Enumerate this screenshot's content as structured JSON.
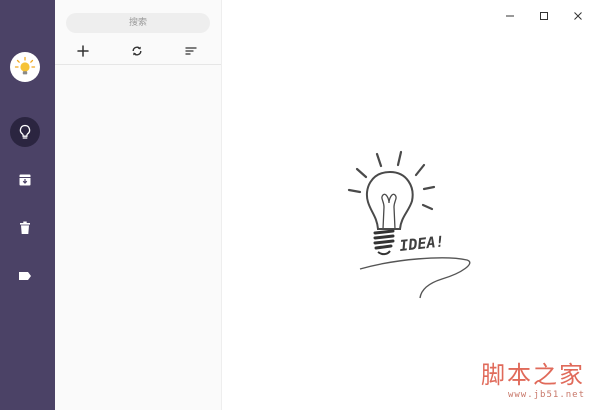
{
  "app": {
    "window_controls": [
      "minimize",
      "maximize",
      "close"
    ]
  },
  "sidebar": {
    "logo_icon": "lightbulb-logo-icon",
    "items": [
      {
        "id": "ideas",
        "icon": "lightbulb-icon",
        "active": true
      },
      {
        "id": "archive",
        "icon": "archive-icon",
        "active": false
      },
      {
        "id": "trash",
        "icon": "trash-icon",
        "active": false
      },
      {
        "id": "tags",
        "icon": "tag-icon",
        "active": false
      }
    ],
    "colors": {
      "background": "#4b4266",
      "active": "#2b2540"
    }
  },
  "list_panel": {
    "search_placeholder": "搜索",
    "toolbar": [
      {
        "id": "add",
        "icon": "plus-icon"
      },
      {
        "id": "sync",
        "icon": "sync-icon"
      },
      {
        "id": "sort",
        "icon": "sort-icon"
      }
    ]
  },
  "empty_state": {
    "text": "IDEA!"
  },
  "watermark": {
    "main": "脚本之家",
    "url": "www.jb51.net"
  }
}
